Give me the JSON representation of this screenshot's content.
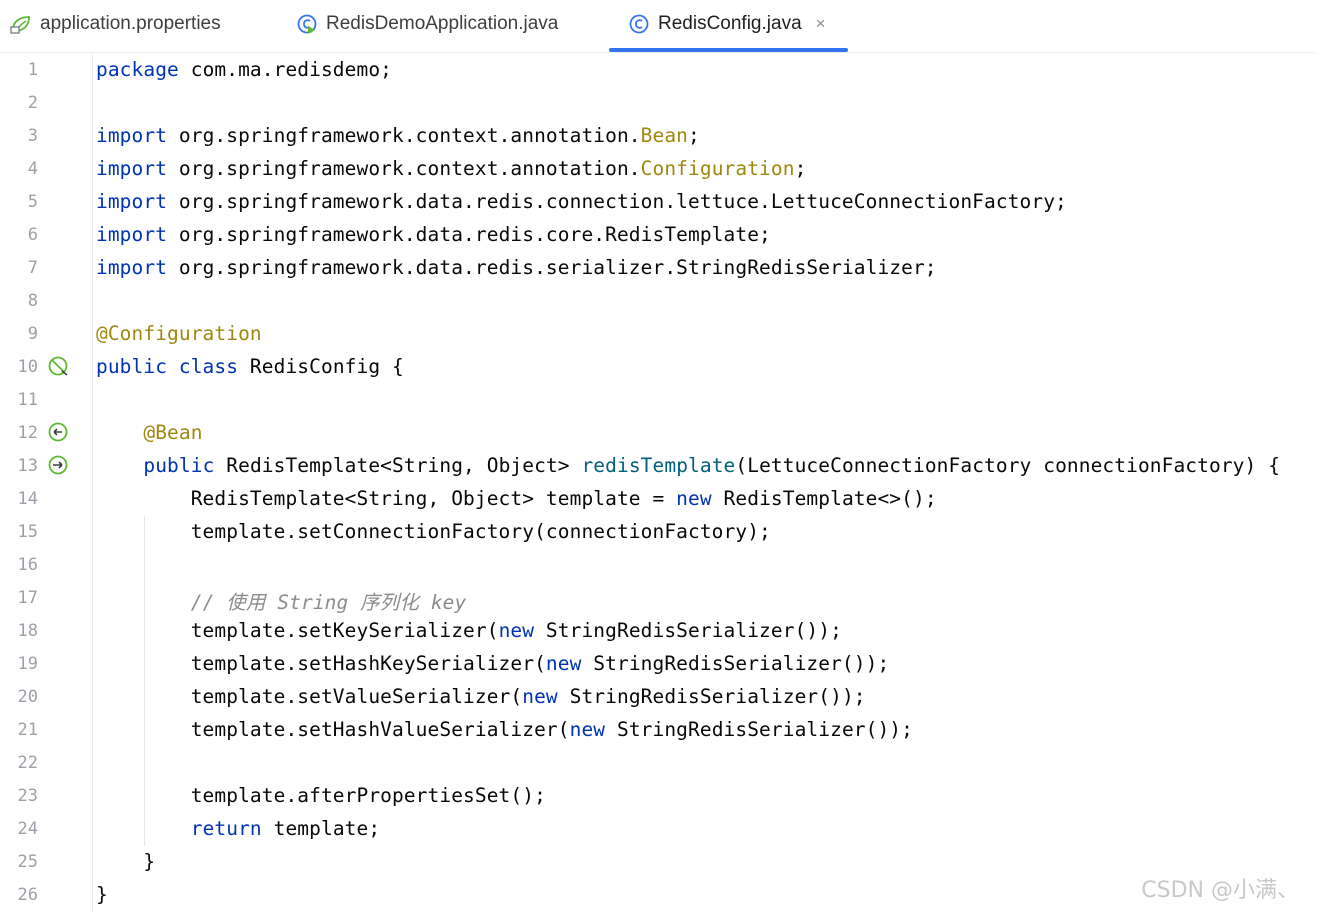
{
  "tabs": [
    {
      "label": "application.properties",
      "icon": "spring-leaf-icon"
    },
    {
      "label": "RedisDemoApplication.java",
      "icon": "run-class-icon"
    },
    {
      "label": "RedisConfig.java",
      "icon": "class-icon",
      "active": true,
      "close": "×"
    }
  ],
  "colors": {
    "accent": "#3574f0",
    "keyword": "#0033b3",
    "annotation": "#9e880d",
    "method": "#00627a",
    "comment": "#8c8c8c"
  },
  "lines": [
    {
      "n": "1",
      "tokens": [
        [
          "kw",
          "package"
        ],
        [
          "t",
          " com.ma.redisdemo;"
        ]
      ]
    },
    {
      "n": "2",
      "tokens": []
    },
    {
      "n": "3",
      "tokens": [
        [
          "kw",
          "import"
        ],
        [
          "t",
          " org.springframework.context.annotation."
        ],
        [
          "ann",
          "Bean"
        ],
        [
          "t",
          ";"
        ]
      ]
    },
    {
      "n": "4",
      "tokens": [
        [
          "kw",
          "import"
        ],
        [
          "t",
          " org.springframework.context.annotation."
        ],
        [
          "ann",
          "Configuration"
        ],
        [
          "t",
          ";"
        ]
      ]
    },
    {
      "n": "5",
      "tokens": [
        [
          "kw",
          "import"
        ],
        [
          "t",
          " org.springframework.data.redis.connection.lettuce.LettuceConnectionFactory;"
        ]
      ]
    },
    {
      "n": "6",
      "tokens": [
        [
          "kw",
          "import"
        ],
        [
          "t",
          " org.springframework.data.redis.core.RedisTemplate;"
        ]
      ]
    },
    {
      "n": "7",
      "tokens": [
        [
          "kw",
          "import"
        ],
        [
          "t",
          " org.springframework.data.redis.serializer.StringRedisSerializer;"
        ]
      ]
    },
    {
      "n": "8",
      "tokens": []
    },
    {
      "n": "9",
      "tokens": [
        [
          "ann",
          "@Configuration"
        ]
      ]
    },
    {
      "n": "10",
      "tokens": [
        [
          "kw",
          "public class"
        ],
        [
          "t",
          " RedisConfig {"
        ]
      ],
      "gutter": "bean-config-icon"
    },
    {
      "n": "11",
      "tokens": []
    },
    {
      "n": "12",
      "tokens": [
        [
          "t",
          "    "
        ],
        [
          "ann",
          "@Bean"
        ]
      ],
      "gutter": "bean-icon"
    },
    {
      "n": "13",
      "tokens": [
        [
          "t",
          "    "
        ],
        [
          "kw",
          "public"
        ],
        [
          "t",
          " RedisTemplate<String, Object> "
        ],
        [
          "fn",
          "redisTemplate"
        ],
        [
          "t",
          "(LettuceConnectionFactory connectionFactory) {"
        ]
      ],
      "gutter": "bean-method-icon"
    },
    {
      "n": "14",
      "tokens": [
        [
          "t",
          "        RedisTemplate<String, Object> template = "
        ],
        [
          "kw",
          "new"
        ],
        [
          "t",
          " RedisTemplate<>();"
        ]
      ]
    },
    {
      "n": "15",
      "tokens": [
        [
          "t",
          "        template.setConnectionFactory(connectionFactory);"
        ]
      ]
    },
    {
      "n": "16",
      "tokens": []
    },
    {
      "n": "17",
      "tokens": [
        [
          "t",
          "        "
        ],
        [
          "cm",
          "// 使用 String 序列化 key"
        ]
      ]
    },
    {
      "n": "18",
      "tokens": [
        [
          "t",
          "        template.setKeySerializer("
        ],
        [
          "kw",
          "new"
        ],
        [
          "t",
          " StringRedisSerializer());"
        ]
      ]
    },
    {
      "n": "19",
      "tokens": [
        [
          "t",
          "        template.setHashKeySerializer("
        ],
        [
          "kw",
          "new"
        ],
        [
          "t",
          " StringRedisSerializer());"
        ]
      ]
    },
    {
      "n": "20",
      "tokens": [
        [
          "t",
          "        template.setValueSerializer("
        ],
        [
          "kw",
          "new"
        ],
        [
          "t",
          " StringRedisSerializer());"
        ]
      ]
    },
    {
      "n": "21",
      "tokens": [
        [
          "t",
          "        template.setHashValueSerializer("
        ],
        [
          "kw",
          "new"
        ],
        [
          "t",
          " StringRedisSerializer());"
        ]
      ]
    },
    {
      "n": "22",
      "tokens": []
    },
    {
      "n": "23",
      "tokens": [
        [
          "t",
          "        template.afterPropertiesSet();"
        ]
      ]
    },
    {
      "n": "24",
      "tokens": [
        [
          "t",
          "        "
        ],
        [
          "kw",
          "return"
        ],
        [
          "t",
          " template;"
        ]
      ]
    },
    {
      "n": "25",
      "tokens": [
        [
          "t",
          "    }"
        ]
      ]
    },
    {
      "n": "26",
      "tokens": [
        [
          "t",
          "}"
        ]
      ]
    }
  ],
  "watermark": "CSDN @小满、"
}
